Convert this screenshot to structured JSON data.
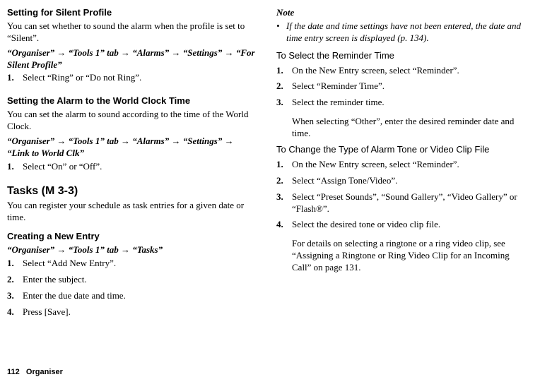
{
  "left": {
    "sec1": {
      "title": "Setting for Silent Profile",
      "desc": "You can set whether to sound the alarm when the profile is set to “Silent”.",
      "path": "“Organiser” → “Tools 1” tab → “Alarms” → “Settings” → “For Silent Profile”",
      "steps": [
        "Select “Ring” or “Do not Ring”."
      ]
    },
    "sec2": {
      "title": "Setting the Alarm to the World Clock Time",
      "desc": "You can set the alarm to sound according to the time of the World Clock.",
      "path": "“Organiser” → “Tools 1” tab → “Alarms” → “Settings” → “Link to World Clk”",
      "steps": [
        "Select “On” or “Off”."
      ]
    },
    "sec3": {
      "title": "Tasks",
      "code": "(M 3-3)",
      "desc": "You can register your schedule as task entries for a given date or time."
    },
    "sec4": {
      "title": "Creating a New Entry",
      "path": "“Organiser” → “Tools 1” tab → “Tasks”",
      "steps": [
        "Select “Add New Entry”.",
        "Enter the subject.",
        "Enter the due date and time.",
        "Press [Save]."
      ]
    }
  },
  "right": {
    "note": {
      "head": "Note",
      "item": "If the date and time settings have not been entered, the date and time entry screen is displayed (p. 134)."
    },
    "sec5": {
      "title": "To Select the Reminder Time",
      "steps": [
        "On the New Entry screen, select “Reminder”.",
        "Select “Reminder Time”.",
        "Select the reminder time."
      ],
      "sub": "When selecting “Other”, enter the desired reminder date and time."
    },
    "sec6": {
      "title": "To Change the Type of Alarm Tone or Video Clip File",
      "steps": [
        "On the New Entry screen, select “Reminder”.",
        "Select “Assign Tone/Video”.",
        "Select “Preset Sounds”, “Sound Gallery”, “Video Gallery” or “Flash®”.",
        "Select the desired tone or video clip file."
      ],
      "sub": "For details on selecting a ringtone or a ring video clip, see “Assigning a Ringtone or Ring Video Clip for an Incoming Call” on page 131."
    }
  },
  "footer": {
    "pagenum": "112",
    "section": "Organiser"
  }
}
